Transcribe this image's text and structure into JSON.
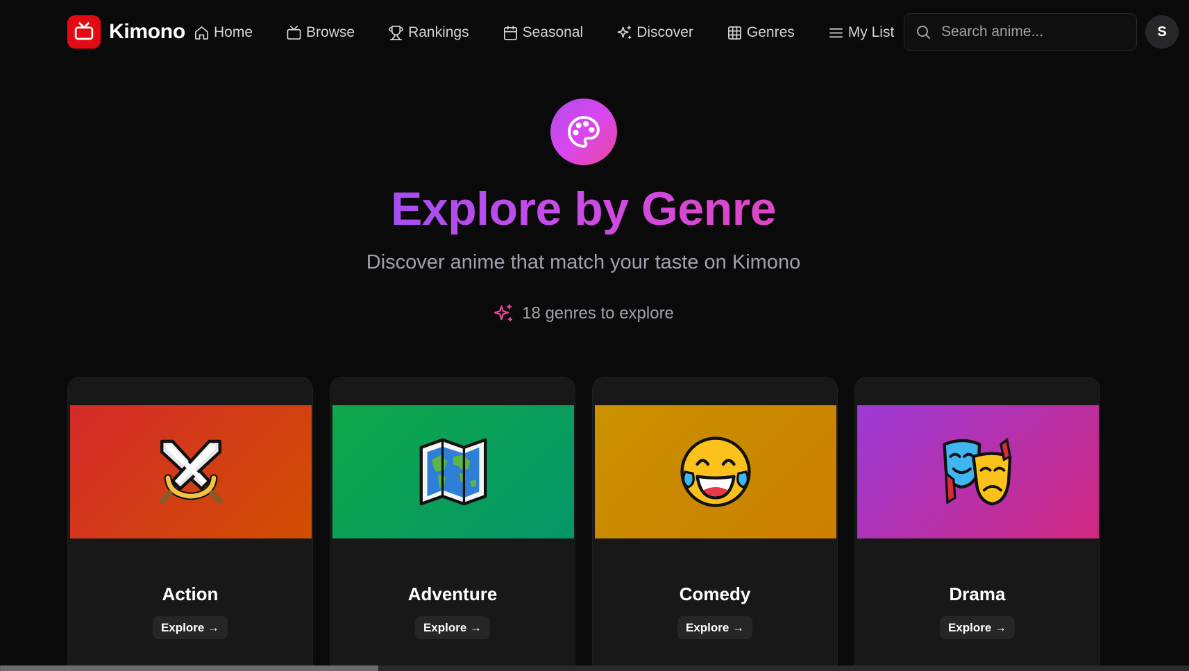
{
  "brand": {
    "name": "Kimono",
    "color": "#e50914"
  },
  "nav": [
    {
      "label": "Home",
      "icon": "home-icon"
    },
    {
      "label": "Browse",
      "icon": "tv-icon"
    },
    {
      "label": "Rankings",
      "icon": "trophy-icon"
    },
    {
      "label": "Seasonal",
      "icon": "calendar-icon"
    },
    {
      "label": "Discover",
      "icon": "sparkles-icon"
    },
    {
      "label": "Genres",
      "icon": "grid-icon"
    },
    {
      "label": "My List",
      "icon": "list-icon"
    }
  ],
  "search": {
    "placeholder": "Search anime...",
    "value": ""
  },
  "user": {
    "initial": "S"
  },
  "hero": {
    "icon": "palette-icon",
    "title": "Explore by Genre",
    "subtitle": "Discover anime that match your taste on Kimono",
    "count_text": "18 genres to explore",
    "accent": "#ec4899"
  },
  "genres": [
    {
      "name": "Action",
      "emoji": "crossed-swords-icon",
      "button": "Explore →",
      "colors": [
        "#d42a2a",
        "#d14f00"
      ]
    },
    {
      "name": "Adventure",
      "emoji": "world-map-icon",
      "button": "Explore →",
      "colors": [
        "#0fa84a",
        "#059669"
      ]
    },
    {
      "name": "Comedy",
      "emoji": "tears-of-joy-icon",
      "button": "Explore →",
      "colors": [
        "#c99100",
        "#cc7f00"
      ]
    },
    {
      "name": "Drama",
      "emoji": "performing-arts-icon",
      "button": "Explore →",
      "colors": [
        "#9b3ad8",
        "#d0287e"
      ]
    }
  ]
}
